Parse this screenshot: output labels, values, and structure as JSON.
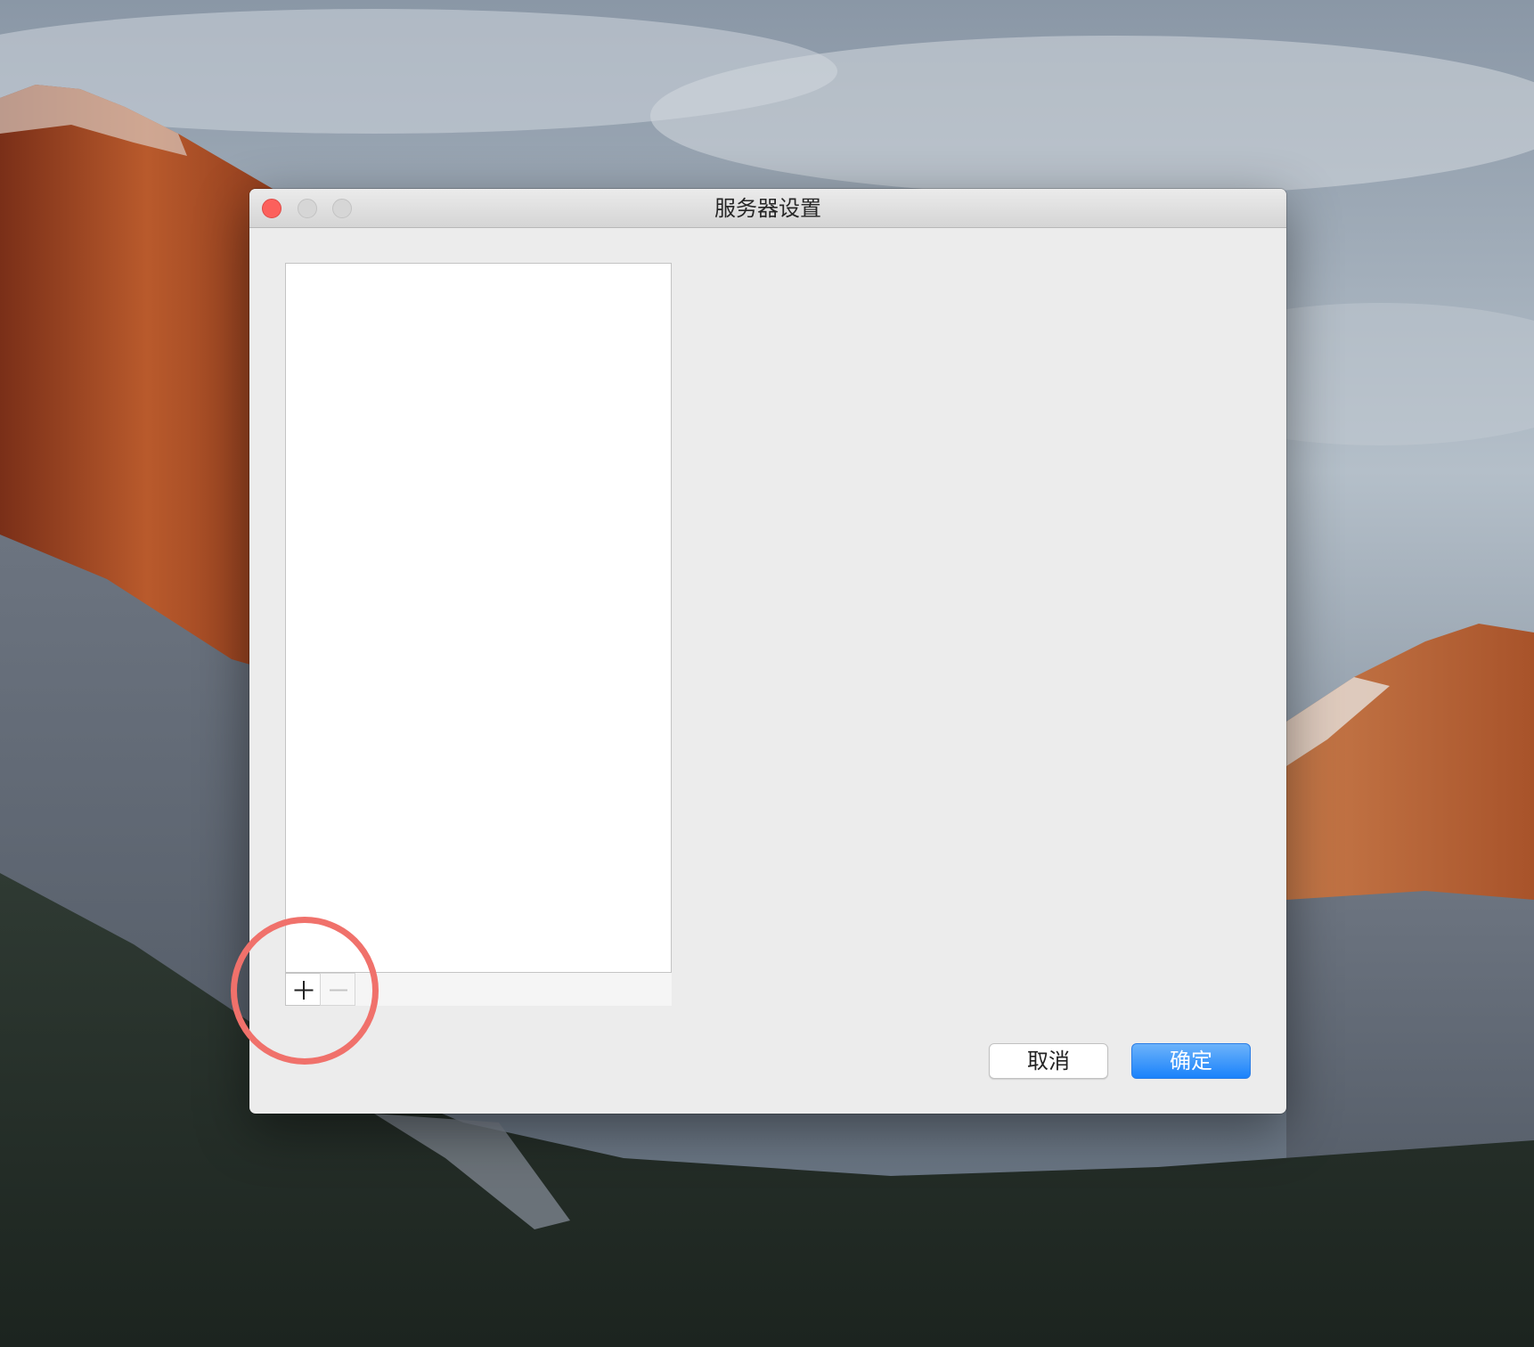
{
  "window": {
    "title": "服务器设置"
  },
  "server_list": {
    "items": [],
    "add_icon": "plus-icon",
    "remove_icon": "minus-icon"
  },
  "buttons": {
    "cancel_label": "取消",
    "ok_label": "确定"
  },
  "colors": {
    "accent": "#1a82fb",
    "close": "#fc605c",
    "highlight": "#f0716b"
  }
}
